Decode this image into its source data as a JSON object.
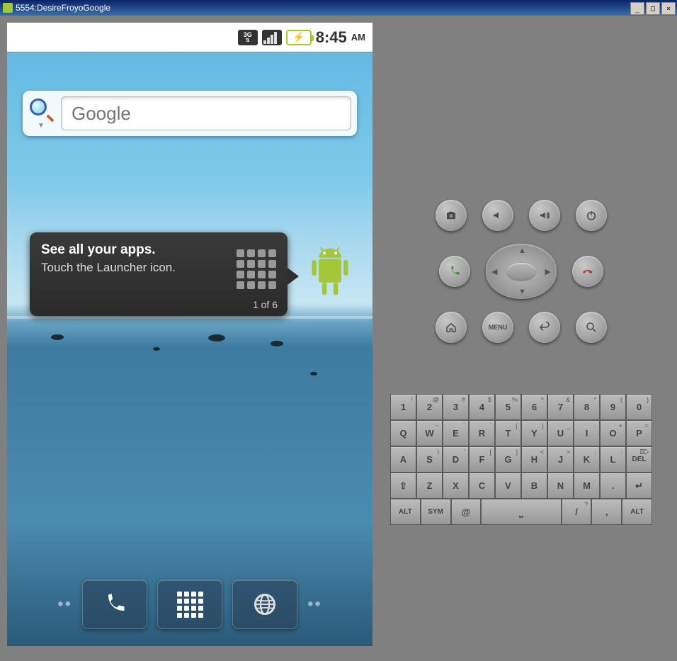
{
  "window": {
    "title": "5554:DesireFroyoGoogle",
    "buttons": {
      "min": "_",
      "max": "□",
      "close": "×"
    }
  },
  "statusbar": {
    "network": "3G",
    "time": "8:45",
    "ampm": "AM"
  },
  "search": {
    "placeholder": "Google"
  },
  "hint": {
    "title": "See all your apps.",
    "subtitle": "Touch the Launcher icon.",
    "count": "1 of 6"
  },
  "controls": {
    "row1": [
      "camera",
      "volume-down",
      "volume-up",
      "power"
    ],
    "row2_left": "call",
    "row2_right": "end-call",
    "row3": [
      "home",
      "menu",
      "back",
      "search"
    ],
    "menu_label": "MENU"
  },
  "keyboard": {
    "row1": [
      {
        "m": "1",
        "s": "!"
      },
      {
        "m": "2",
        "s": "@"
      },
      {
        "m": "3",
        "s": "#"
      },
      {
        "m": "4",
        "s": "$"
      },
      {
        "m": "5",
        "s": "%"
      },
      {
        "m": "6",
        "s": "^"
      },
      {
        "m": "7",
        "s": "&"
      },
      {
        "m": "8",
        "s": "*"
      },
      {
        "m": "9",
        "s": "("
      },
      {
        "m": "0",
        "s": ")"
      }
    ],
    "row2": [
      {
        "m": "Q"
      },
      {
        "m": "W",
        "s": "~"
      },
      {
        "m": "E",
        "s": "´"
      },
      {
        "m": "R",
        "s": "`"
      },
      {
        "m": "T",
        "s": "{"
      },
      {
        "m": "Y",
        "s": "}"
      },
      {
        "m": "U",
        "s": "_"
      },
      {
        "m": "I",
        "s": "-"
      },
      {
        "m": "O",
        "s": "+"
      },
      {
        "m": "P",
        "s": "="
      }
    ],
    "row3": [
      {
        "m": "A"
      },
      {
        "m": "S",
        "s": "\\"
      },
      {
        "m": "D",
        "s": "'"
      },
      {
        "m": "F",
        "s": "["
      },
      {
        "m": "G",
        "s": "]"
      },
      {
        "m": "H",
        "s": "<"
      },
      {
        "m": "J",
        "s": ">"
      },
      {
        "m": "K",
        "s": ";"
      },
      {
        "m": "L",
        "s": ":"
      },
      {
        "m": "DEL",
        "small": true,
        "s": "⌦"
      }
    ],
    "row4": [
      {
        "m": "⇧"
      },
      {
        "m": "Z"
      },
      {
        "m": "X"
      },
      {
        "m": "C"
      },
      {
        "m": "V"
      },
      {
        "m": "B"
      },
      {
        "m": "N"
      },
      {
        "m": "M",
        "s": "."
      },
      {
        "m": "."
      },
      {
        "m": "↵"
      }
    ],
    "row5": [
      {
        "m": "ALT",
        "small": true,
        "cls": "w15"
      },
      {
        "m": "SYM",
        "small": true,
        "cls": "w15"
      },
      {
        "m": "@",
        "cls": "w15"
      },
      {
        "m": "⎵",
        "cls": "space"
      },
      {
        "m": "/",
        "s": "?",
        "cls": "w15"
      },
      {
        "m": ",",
        "cls": "w15"
      },
      {
        "m": "ALT",
        "small": true,
        "cls": "w15"
      }
    ]
  }
}
